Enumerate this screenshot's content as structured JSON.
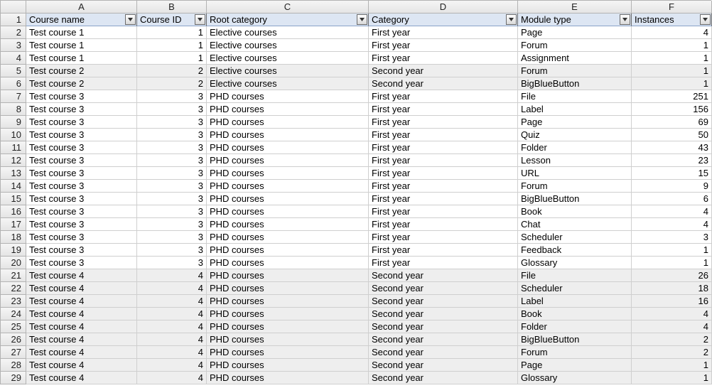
{
  "columns": [
    "A",
    "B",
    "C",
    "D",
    "E",
    "F"
  ],
  "headers": [
    "Course name",
    "Course ID",
    "Root category",
    "Category",
    "Module type",
    "Instances"
  ],
  "rows": [
    {
      "shade": false,
      "cells": [
        "Test course 1",
        "1",
        "Elective courses",
        "First year",
        "Page",
        "4"
      ]
    },
    {
      "shade": false,
      "cells": [
        "Test course 1",
        "1",
        "Elective courses",
        "First year",
        "Forum",
        "1"
      ]
    },
    {
      "shade": false,
      "cells": [
        "Test course 1",
        "1",
        "Elective courses",
        "First year",
        "Assignment",
        "1"
      ]
    },
    {
      "shade": true,
      "cells": [
        "Test course 2",
        "2",
        "Elective courses",
        "Second year",
        "Forum",
        "1"
      ]
    },
    {
      "shade": true,
      "cells": [
        "Test course 2",
        "2",
        "Elective courses",
        "Second year",
        "BigBlueButton",
        "1"
      ]
    },
    {
      "shade": false,
      "cells": [
        "Test course 3",
        "3",
        "PHD courses",
        "First year",
        "File",
        "251"
      ]
    },
    {
      "shade": false,
      "cells": [
        "Test course 3",
        "3",
        "PHD courses",
        "First year",
        "Label",
        "156"
      ]
    },
    {
      "shade": false,
      "cells": [
        "Test course 3",
        "3",
        "PHD courses",
        "First year",
        "Page",
        "69"
      ]
    },
    {
      "shade": false,
      "cells": [
        "Test course 3",
        "3",
        "PHD courses",
        "First year",
        "Quiz",
        "50"
      ]
    },
    {
      "shade": false,
      "cells": [
        "Test course 3",
        "3",
        "PHD courses",
        "First year",
        "Folder",
        "43"
      ]
    },
    {
      "shade": false,
      "cells": [
        "Test course 3",
        "3",
        "PHD courses",
        "First year",
        "Lesson",
        "23"
      ]
    },
    {
      "shade": false,
      "cells": [
        "Test course 3",
        "3",
        "PHD courses",
        "First year",
        "URL",
        "15"
      ]
    },
    {
      "shade": false,
      "cells": [
        "Test course 3",
        "3",
        "PHD courses",
        "First year",
        "Forum",
        "9"
      ]
    },
    {
      "shade": false,
      "cells": [
        "Test course 3",
        "3",
        "PHD courses",
        "First year",
        "BigBlueButton",
        "6"
      ]
    },
    {
      "shade": false,
      "cells": [
        "Test course 3",
        "3",
        "PHD courses",
        "First year",
        "Book",
        "4"
      ]
    },
    {
      "shade": false,
      "cells": [
        "Test course 3",
        "3",
        "PHD courses",
        "First year",
        "Chat",
        "4"
      ]
    },
    {
      "shade": false,
      "cells": [
        "Test course 3",
        "3",
        "PHD courses",
        "First year",
        "Scheduler",
        "3"
      ]
    },
    {
      "shade": false,
      "cells": [
        "Test course 3",
        "3",
        "PHD courses",
        "First year",
        "Feedback",
        "1"
      ]
    },
    {
      "shade": false,
      "cells": [
        "Test course 3",
        "3",
        "PHD courses",
        "First year",
        "Glossary",
        "1"
      ]
    },
    {
      "shade": true,
      "cells": [
        "Test course 4",
        "4",
        "PHD courses",
        "Second year",
        "File",
        "26"
      ]
    },
    {
      "shade": true,
      "cells": [
        "Test course 4",
        "4",
        "PHD courses",
        "Second year",
        "Scheduler",
        "18"
      ]
    },
    {
      "shade": true,
      "cells": [
        "Test course 4",
        "4",
        "PHD courses",
        "Second year",
        "Label",
        "16"
      ]
    },
    {
      "shade": true,
      "cells": [
        "Test course 4",
        "4",
        "PHD courses",
        "Second year",
        "Book",
        "4"
      ]
    },
    {
      "shade": true,
      "cells": [
        "Test course 4",
        "4",
        "PHD courses",
        "Second year",
        "Folder",
        "4"
      ]
    },
    {
      "shade": true,
      "cells": [
        "Test course 4",
        "4",
        "PHD courses",
        "Second year",
        "BigBlueButton",
        "2"
      ]
    },
    {
      "shade": true,
      "cells": [
        "Test course 4",
        "4",
        "PHD courses",
        "Second year",
        "Forum",
        "2"
      ]
    },
    {
      "shade": true,
      "cells": [
        "Test course 4",
        "4",
        "PHD courses",
        "Second year",
        "Page",
        "1"
      ]
    },
    {
      "shade": true,
      "cells": [
        "Test course 4",
        "4",
        "PHD courses",
        "Second year",
        "Glossary",
        "1"
      ]
    }
  ],
  "numeric_cols": [
    1,
    5
  ],
  "chart_data": {
    "type": "table",
    "title": "",
    "columns": [
      "Course name",
      "Course ID",
      "Root category",
      "Category",
      "Module type",
      "Instances"
    ],
    "rows": [
      [
        "Test course 1",
        1,
        "Elective courses",
        "First year",
        "Page",
        4
      ],
      [
        "Test course 1",
        1,
        "Elective courses",
        "First year",
        "Forum",
        1
      ],
      [
        "Test course 1",
        1,
        "Elective courses",
        "First year",
        "Assignment",
        1
      ],
      [
        "Test course 2",
        2,
        "Elective courses",
        "Second year",
        "Forum",
        1
      ],
      [
        "Test course 2",
        2,
        "Elective courses",
        "Second year",
        "BigBlueButton",
        1
      ],
      [
        "Test course 3",
        3,
        "PHD courses",
        "First year",
        "File",
        251
      ],
      [
        "Test course 3",
        3,
        "PHD courses",
        "First year",
        "Label",
        156
      ],
      [
        "Test course 3",
        3,
        "PHD courses",
        "First year",
        "Page",
        69
      ],
      [
        "Test course 3",
        3,
        "PHD courses",
        "First year",
        "Quiz",
        50
      ],
      [
        "Test course 3",
        3,
        "PHD courses",
        "First year",
        "Folder",
        43
      ],
      [
        "Test course 3",
        3,
        "PHD courses",
        "First year",
        "Lesson",
        23
      ],
      [
        "Test course 3",
        3,
        "PHD courses",
        "First year",
        "URL",
        15
      ],
      [
        "Test course 3",
        3,
        "PHD courses",
        "First year",
        "Forum",
        9
      ],
      [
        "Test course 3",
        3,
        "PHD courses",
        "First year",
        "BigBlueButton",
        6
      ],
      [
        "Test course 3",
        3,
        "PHD courses",
        "First year",
        "Book",
        4
      ],
      [
        "Test course 3",
        3,
        "PHD courses",
        "First year",
        "Chat",
        4
      ],
      [
        "Test course 3",
        3,
        "PHD courses",
        "First year",
        "Scheduler",
        3
      ],
      [
        "Test course 3",
        3,
        "PHD courses",
        "First year",
        "Feedback",
        1
      ],
      [
        "Test course 3",
        3,
        "PHD courses",
        "First year",
        "Glossary",
        1
      ],
      [
        "Test course 4",
        4,
        "PHD courses",
        "Second year",
        "File",
        26
      ],
      [
        "Test course 4",
        4,
        "PHD courses",
        "Second year",
        "Scheduler",
        18
      ],
      [
        "Test course 4",
        4,
        "PHD courses",
        "Second year",
        "Label",
        16
      ],
      [
        "Test course 4",
        4,
        "PHD courses",
        "Second year",
        "Book",
        4
      ],
      [
        "Test course 4",
        4,
        "PHD courses",
        "Second year",
        "Folder",
        4
      ],
      [
        "Test course 4",
        4,
        "PHD courses",
        "Second year",
        "BigBlueButton",
        2
      ],
      [
        "Test course 4",
        4,
        "PHD courses",
        "Second year",
        "Forum",
        2
      ],
      [
        "Test course 4",
        4,
        "PHD courses",
        "Second year",
        "Page",
        1
      ],
      [
        "Test course 4",
        4,
        "PHD courses",
        "Second year",
        "Glossary",
        1
      ]
    ]
  }
}
